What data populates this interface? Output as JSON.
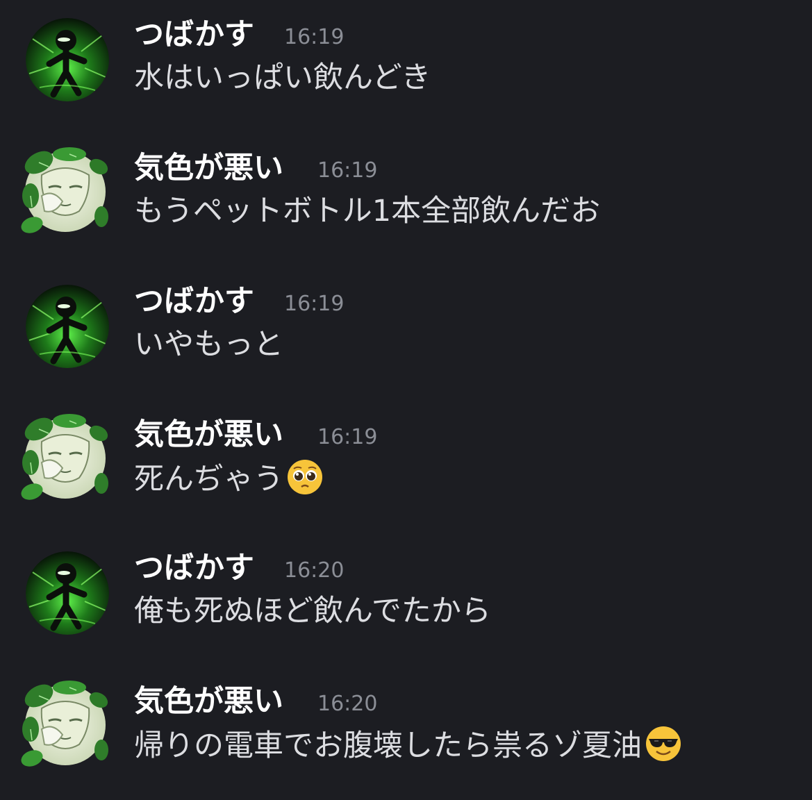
{
  "messages": [
    {
      "author": "つばかす",
      "avatar": "dark-stickman-avatar",
      "time": "16:19",
      "text": "水はいっぱい飲んどき",
      "emoji": ""
    },
    {
      "author": "気色が悪い",
      "avatar": "leafy-character-avatar",
      "time": "16:19",
      "text": "もうペットボトル1本全部飲んだお",
      "emoji": ""
    },
    {
      "author": "つばかす",
      "avatar": "dark-stickman-avatar",
      "time": "16:19",
      "text": "いやもっと",
      "emoji": ""
    },
    {
      "author": "気色が悪い",
      "avatar": "leafy-character-avatar",
      "time": "16:19",
      "text": "死んぢゃう",
      "emoji": "pleading-face-emoji"
    },
    {
      "author": "つばかす",
      "avatar": "dark-stickman-avatar",
      "time": "16:20",
      "text": "俺も死ぬほど飲んでたから",
      "emoji": ""
    },
    {
      "author": "気色が悪い",
      "avatar": "leafy-character-avatar",
      "time": "16:20",
      "text": "帰りの電車でお腹壊したら祟るゾ夏油",
      "emoji": "sunglasses-face-emoji"
    }
  ],
  "colors": {
    "background": "#1c1d22",
    "author": "#ffffff",
    "timestamp": "#8b8e96",
    "message_text": "#dcdde1",
    "accent_green": "#3fb83a"
  }
}
